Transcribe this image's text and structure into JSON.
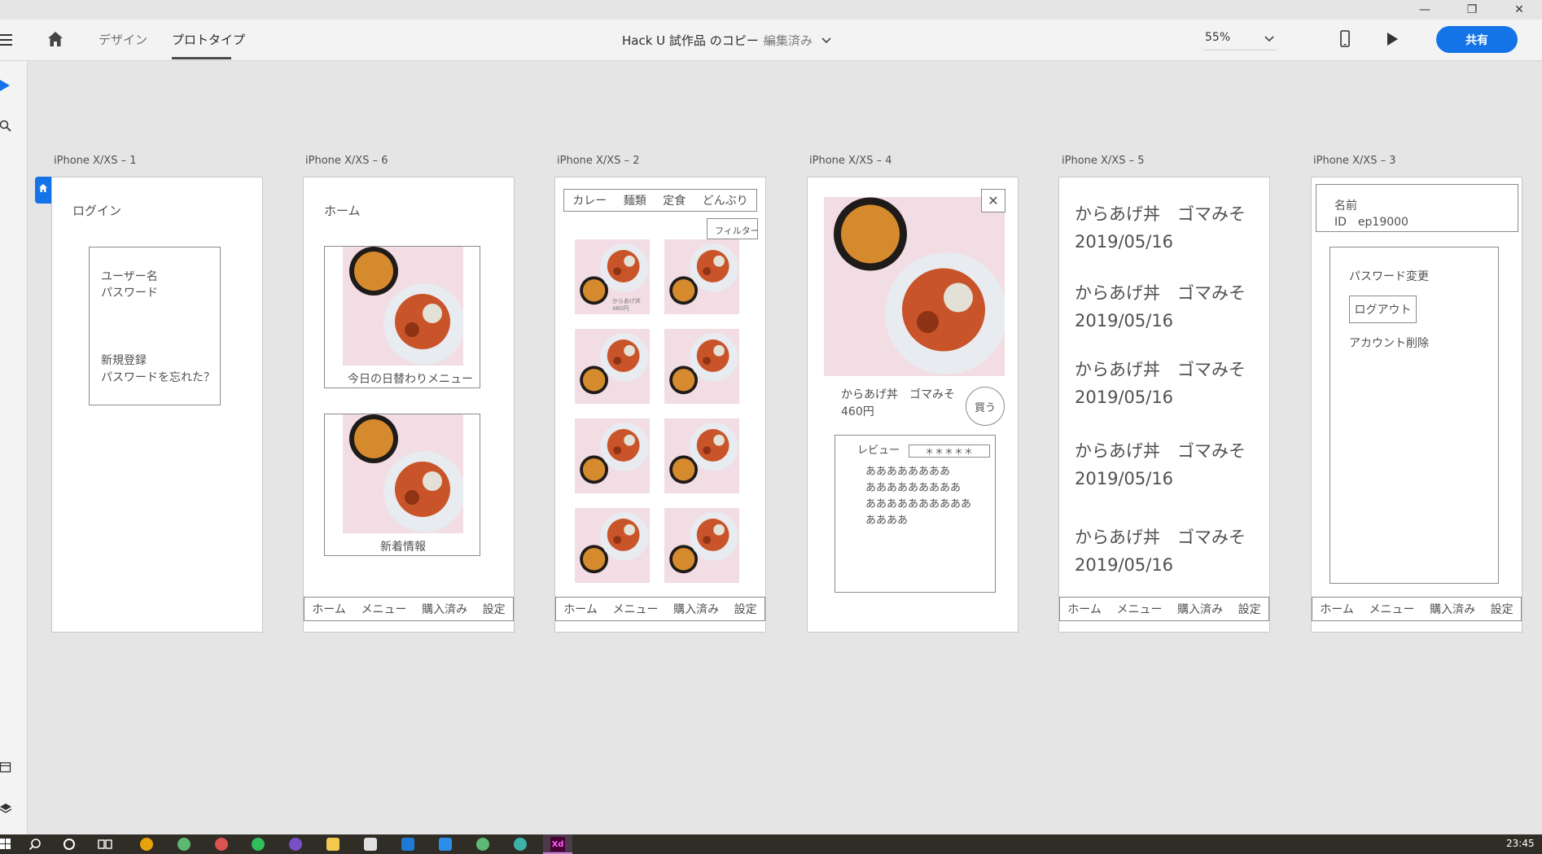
{
  "window_controls": {
    "minimize": "—",
    "maximize": "❐",
    "close": "✕"
  },
  "appbar": {
    "tabs": [
      {
        "label": "デザイン"
      },
      {
        "label": "プロトタイプ"
      }
    ],
    "doc_title": "Hack U 試作品 のコピー",
    "doc_separator": "—",
    "doc_status": "編集済み",
    "zoom": "55%",
    "share": "共有"
  },
  "artboards": {
    "a1": {
      "label": "iPhone X/XS – 1",
      "login": "ログイン",
      "username": "ユーザー名",
      "password": "パスワード",
      "register": "新規登録",
      "forgot": "パスワードを忘れた？"
    },
    "a6": {
      "label": "iPhone X/XS – 6",
      "home": "ホーム",
      "daily": "今日の日替わりメニュー",
      "news": "新着情報"
    },
    "a2": {
      "label": "iPhone X/XS – 2",
      "categories": [
        "カレー",
        "麺類",
        "定食",
        "どんぶり"
      ],
      "filter": "フィルター",
      "thumb_name": "からあげ丼",
      "thumb_price": "460円"
    },
    "a4": {
      "label": "iPhone X/XS – 4",
      "close": "✕",
      "item_name": "からあげ丼　ゴマみそ",
      "item_price": "460円",
      "buy": "買う",
      "review_label": "レビュー",
      "stars": "＊＊＊＊＊",
      "review_lines": [
        "ああああああああ",
        "あああああああああ",
        "ああああああああああ",
        "ああああ"
      ]
    },
    "a5": {
      "label": "iPhone X/XS – 5",
      "entries": [
        {
          "name": "からあげ丼　ゴマみそ",
          "date": "2019/05/16"
        },
        {
          "name": "からあげ丼　ゴマみそ",
          "date": "2019/05/16"
        },
        {
          "name": "からあげ丼　ゴマみそ",
          "date": "2019/05/16"
        },
        {
          "name": "からあげ丼　ゴマみそ",
          "date": "2019/05/16"
        },
        {
          "name": "からあげ丼　ゴマみそ",
          "date": "2019/05/16"
        }
      ]
    },
    "a3": {
      "label": "iPhone X/XS – 3",
      "name": "名前",
      "id": "ID　ep19000",
      "change_password": "パスワード変更",
      "logout": "ログアウト",
      "delete_account": "アカウント削除"
    }
  },
  "tabbar": {
    "home": "ホーム",
    "menu": "メニュー",
    "purchased": "購入済み",
    "settings": "設定"
  },
  "taskbar": {
    "clock": "23:45"
  },
  "colors": {
    "accent": "#1473e6",
    "taskbar": "#2f2d26",
    "canvas": "#e5e5e5"
  }
}
